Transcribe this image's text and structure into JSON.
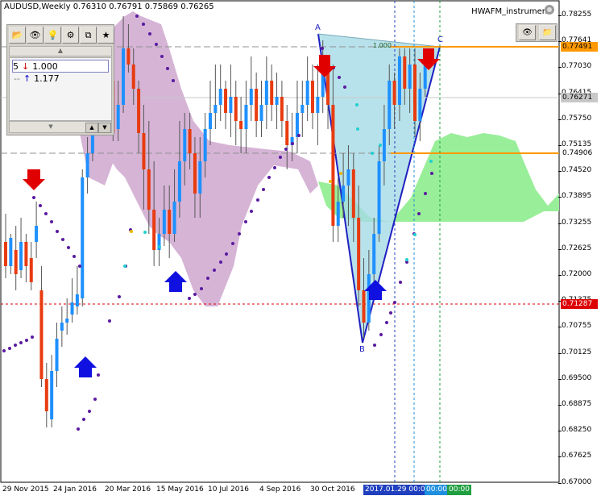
{
  "header": {
    "symbol": "AUDUSD,Weekly",
    "ohlc": "0.76310 0.76791 0.75869 0.76265"
  },
  "object_list": {
    "items": [
      {
        "num": "5",
        "arrow": "↓",
        "value": "1.000"
      },
      {
        "num": "",
        "arrow": "↑",
        "value": "1.177"
      }
    ]
  },
  "indicator": {
    "name": "HWAFM_instrument"
  },
  "price_axis": {
    "labels": [
      "0.78255",
      "0.77641",
      "0.77030",
      "0.76415",
      "0.75750",
      "0.75135",
      "0.74520",
      "0.73895",
      "0.73255",
      "0.72625",
      "0.72000",
      "0.71375",
      "0.70755",
      "0.70125",
      "0.69500",
      "0.68875",
      "0.68250",
      "0.67625",
      "0.67000"
    ],
    "highlights": [
      {
        "value": "0.77491",
        "color": "#ff9900",
        "text_color": "#000000"
      },
      {
        "value": "0.76271",
        "color": "#c8c8c8",
        "text_color": "#000000"
      },
      {
        "value": "0.74906",
        "color": "#ffffff",
        "text_color": "#000000"
      },
      {
        "value": "0.71287",
        "color": "#dd0000",
        "text_color": "#ffffff"
      }
    ]
  },
  "time_axis": {
    "labels": [
      "29 Nov 2015",
      "24 Jan 2016",
      "20 Mar 2016",
      "15 May 2016",
      "10 Jul 2016",
      "4 Sep 2016",
      "30 Oct 2016"
    ],
    "highlighted": [
      {
        "text": "2017.01.29 00:00",
        "color": "#1f3fbf"
      },
      {
        "text": "00:00",
        "color": "#1f8fdf"
      },
      {
        "text": "00:00",
        "color": "#1f9f3f"
      }
    ]
  },
  "pattern": {
    "point_a": "A",
    "point_b": "B",
    "point_c": "C",
    "ratio_label": "1.000"
  },
  "colors": {
    "bull": "#1e90ff",
    "bear": "#e83b10",
    "cloud_down": "#d6b4d6",
    "cloud_up": "#99ee99",
    "pattern_fill": "#a6dbe6",
    "pattern_line": "#2020c0",
    "sar": "#5a1aa0"
  }
}
